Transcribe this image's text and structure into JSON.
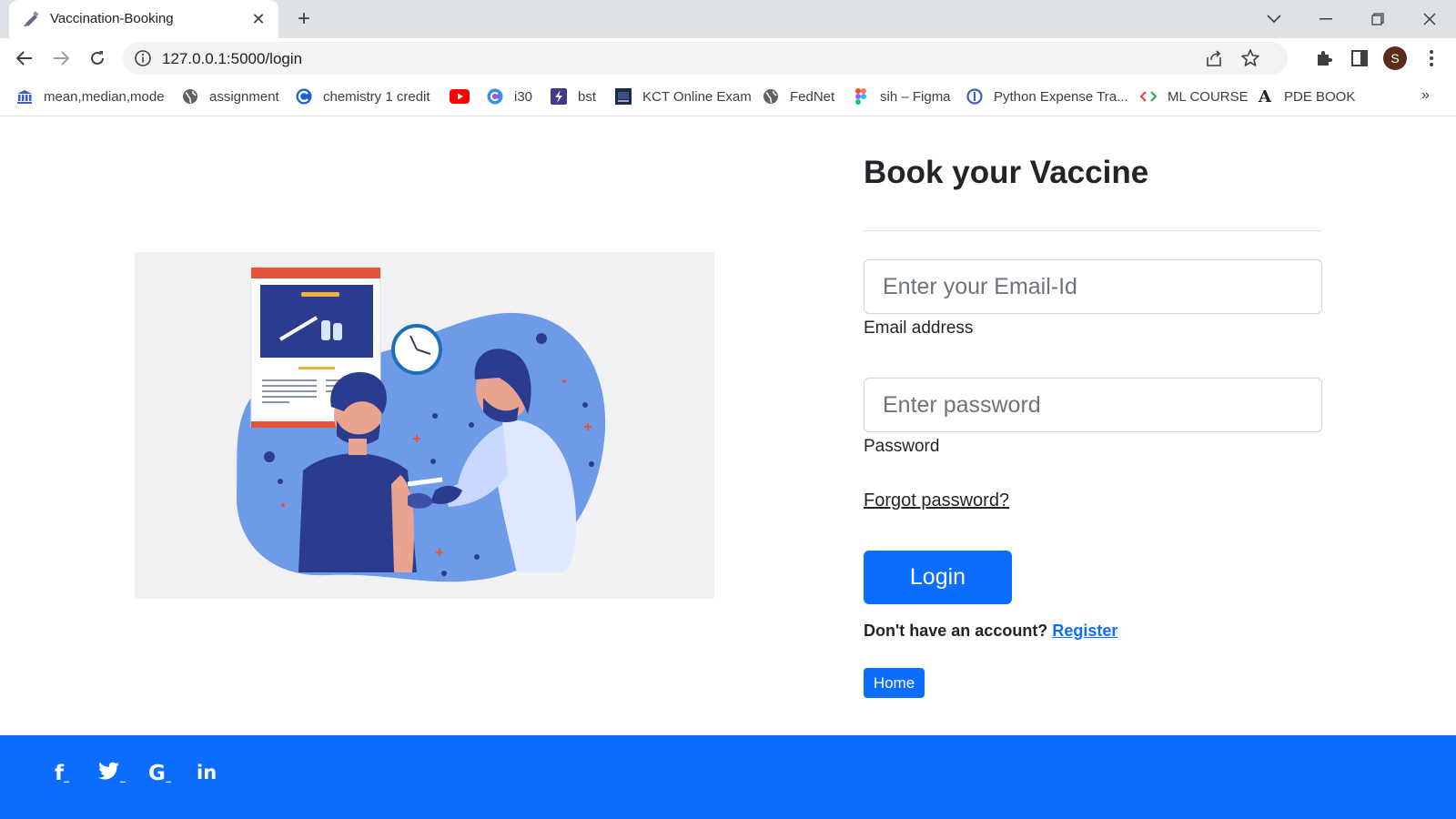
{
  "browser": {
    "tab_title": "Vaccination-Booking",
    "tab_close": "✕",
    "new_tab": "+",
    "url": "127.0.0.1:5000/login",
    "profile_initial": "S",
    "bookmarks_more": "»",
    "bookmarks": [
      {
        "label": "mean,median,mode",
        "icon": "bank-icon"
      },
      {
        "label": "assignment",
        "icon": "globe-icon"
      },
      {
        "label": "chemistry 1 credit",
        "icon": "coursera-icon"
      },
      {
        "label": "",
        "icon": "youtube-icon"
      },
      {
        "label": "i30",
        "icon": "codechef-icon"
      },
      {
        "label": "bst",
        "icon": "bolt-icon"
      },
      {
        "label": "KCT Online Exam",
        "icon": "kct-icon"
      },
      {
        "label": "FedNet",
        "icon": "globe-icon"
      },
      {
        "label": "sih – Figma",
        "icon": "figma-icon"
      },
      {
        "label": "Python Expense Tra...",
        "icon": "replit-icon"
      },
      {
        "label": "ML COURSE",
        "icon": "code-icon"
      },
      {
        "label": "PDE BOOK",
        "icon": "font-icon"
      }
    ]
  },
  "page": {
    "heading": "Book your Vaccine",
    "email": {
      "placeholder": "Enter your Email-Id",
      "label": "Email address"
    },
    "password": {
      "placeholder": "Enter password",
      "label": "Password"
    },
    "forgot_password": "Forgot password?",
    "login_button": "Login",
    "no_account_text": "Don't have an account?",
    "register_link": "Register",
    "home_button": "Home"
  },
  "footer": {
    "social": [
      {
        "label": "f",
        "icon": "facebook-icon"
      },
      {
        "label": "𝕥",
        "icon": "twitter-icon"
      },
      {
        "label": "G",
        "icon": "google-icon"
      },
      {
        "label": "in",
        "icon": "linkedin-icon"
      }
    ]
  },
  "colors": {
    "primary": "#0d6efd",
    "illustration_bg": "#f0f1f2",
    "blob": "#6d9be8",
    "navy": "#2b3c8f",
    "calendar_red": "#e5533c"
  }
}
